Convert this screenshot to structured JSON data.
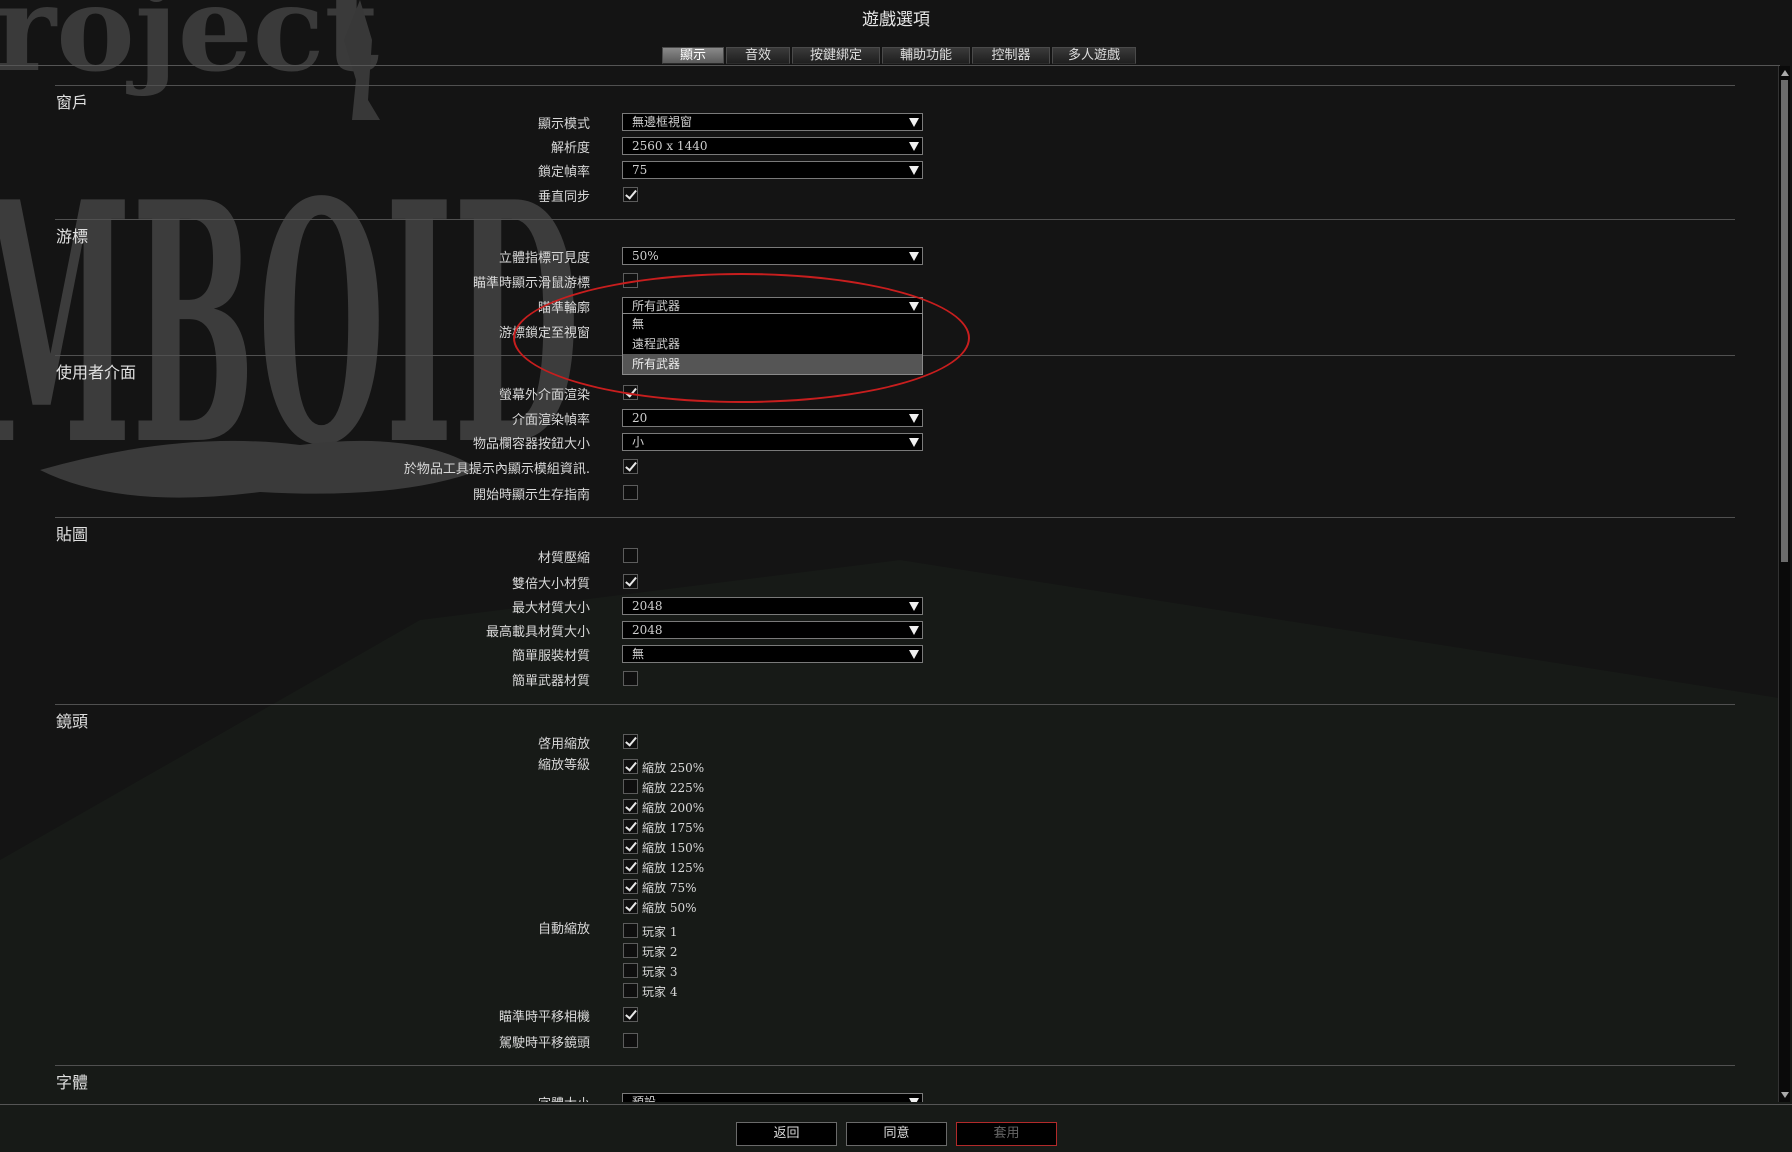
{
  "window": {
    "title": "遊戲選項"
  },
  "tabs": [
    "顯示",
    "音效",
    "按鍵綁定",
    "輔助功能",
    "控制器",
    "多人遊戲"
  ],
  "sections": {
    "window": {
      "title": "窗戶",
      "display_mode": {
        "label": "顯示模式",
        "value": "無邊框視窗"
      },
      "resolution": {
        "label": "解析度",
        "value": "2560 x 1440"
      },
      "framerate": {
        "label": "鎖定幀率",
        "value": "75"
      },
      "vsync": {
        "label": "垂直同步",
        "checked": true
      }
    },
    "cursor": {
      "title": "游標",
      "aim_visibility": {
        "label": "立體指標可見度",
        "value": "50%"
      },
      "show_mouse_on_aim": {
        "label": "瞄準時顯示滑鼠游標",
        "checked": false
      },
      "aim_outline": {
        "label": "瞄準輪廓",
        "value": "所有武器"
      },
      "lock_cursor": {
        "label": "游標鎖定至視窗"
      }
    },
    "ui": {
      "title": "使用者介面",
      "offscreen_render": {
        "label": "螢幕外介面渲染",
        "checked": true
      },
      "ui_fps": {
        "label": "介面渲染幀率",
        "value": "20"
      },
      "container_button_size": {
        "label": "物品欄容器按鈕大小",
        "value": "小"
      },
      "mod_info_tooltip": {
        "label": "於物品工具提示內顯示模組資訊.",
        "checked": true
      },
      "survival_guide": {
        "label": "開始時顯示生存指南",
        "checked": false
      }
    },
    "textures": {
      "title": "貼圖",
      "compression": {
        "label": "材質壓縮",
        "checked": false
      },
      "double_size": {
        "label": "雙倍大小材質",
        "checked": true
      },
      "max_size": {
        "label": "最大材質大小",
        "value": "2048"
      },
      "max_vehicle_size": {
        "label": "最高載具材質大小",
        "value": "2048"
      },
      "simple_clothing": {
        "label": "簡單服裝材質",
        "value": "無"
      },
      "simple_weapon": {
        "label": "簡單武器材質",
        "checked": false
      }
    },
    "camera": {
      "title": "鏡頭",
      "enable_zoom": {
        "label": "啓用縮放",
        "checked": true
      },
      "zoom_levels": {
        "label": "縮放等級",
        "items": [
          {
            "label": "縮放 250%",
            "checked": true
          },
          {
            "label": "縮放 225%",
            "checked": false
          },
          {
            "label": "縮放 200%",
            "checked": true
          },
          {
            "label": "縮放 175%",
            "checked": true
          },
          {
            "label": "縮放 150%",
            "checked": true
          },
          {
            "label": "縮放 125%",
            "checked": true
          },
          {
            "label": "縮放 75%",
            "checked": true
          },
          {
            "label": "縮放 50%",
            "checked": true
          }
        ]
      },
      "auto_zoom": {
        "label": "自動縮放",
        "items": [
          {
            "label": "玩家 1",
            "checked": false
          },
          {
            "label": "玩家 2",
            "checked": false
          },
          {
            "label": "玩家 3",
            "checked": false
          },
          {
            "label": "玩家 4",
            "checked": false
          }
        ]
      },
      "pan_on_aim": {
        "label": "瞄準時平移相機",
        "checked": true
      },
      "pan_on_drive": {
        "label": "駕駛時平移鏡頭",
        "checked": false
      }
    },
    "fonts": {
      "title": "字體",
      "font_size": {
        "label": "字體大小",
        "value": "預設"
      }
    }
  },
  "dropdown": {
    "options": [
      "無",
      "遠程武器",
      "所有武器"
    ],
    "selected": "所有武器"
  },
  "buttons": {
    "back": "返回",
    "accept": "同意",
    "apply": "套用"
  },
  "colors": {
    "highlight": "#c81e1e",
    "apply_border": "#b22a2a"
  }
}
